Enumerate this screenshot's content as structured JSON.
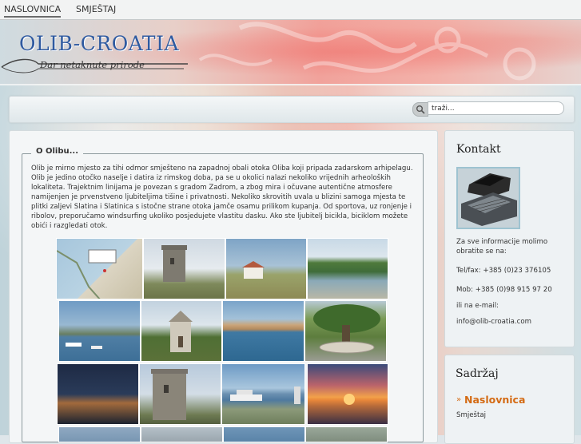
{
  "topnav": {
    "items": [
      "NASLOVNICA",
      "SMJEŠTAJ"
    ]
  },
  "header": {
    "title": "OLIB-CROATIA",
    "subtitle": "Dar netaknute prirode"
  },
  "search": {
    "value": "traži..."
  },
  "article": {
    "legend": "O Olibu...",
    "body": "Olib je mirno mjesto za tihi odmor smješteno na zapadnoj obali otoka Oliba koji pripada zadarskom arhipelagu. Olib je jedino otočko naselje i datira iz rimskog doba, pa se u okolici nalazi nekoliko vrijednih arheoloških lokaliteta. Trajektnim linijama je povezan s gradom Zadrom, a zbog mira i očuvane autentične atmosfere namijenjen je prvenstveno ljubiteljima tišine i privatnosti. Nekoliko skrovitih uvala u blizini samoga mjesta te plitki zaljevi Slatina i Slatinica s istočne strane otoka jamče osamu prilikom kupanja. Od sportova, uz ronjenje i ribolov, preporučamo windsurfing ukoliko posjedujete vlastitu dasku. Ako ste ljubitelj bicikla, biciklom možete obići i razgledati otok."
  },
  "gallery_icons": [
    "map-thumbnail",
    "stone-tower-thumbnail",
    "coastal-house-thumbnail",
    "shoreline-trees-thumbnail",
    "harbor-thumbnail",
    "chapel-thumbnail",
    "village-waterfront-thumbnail",
    "old-tree-thumbnail",
    "night-harbor-thumbnail",
    "fortress-tower-thumbnail",
    "ferry-port-thumbnail",
    "sunset-thumbnail"
  ],
  "sidebar": {
    "kontakt": {
      "title": "Kontakt",
      "intro": "Za sve informacije molimo obratite se na:",
      "tel": "Tel/fax: +385 (0)23 376105",
      "mob": "Mob: +385 (0)98 915 97 20",
      "email_intro": "ili na e-mail:",
      "email": "info@olib-croatia.com"
    },
    "sadrzaj": {
      "title": "Sadržaj",
      "bullet": "»",
      "items": [
        "Naslovnica",
        "Smještaj"
      ]
    }
  },
  "colors": {
    "accent": "#d46b14",
    "logo": "#2f5aa0"
  }
}
